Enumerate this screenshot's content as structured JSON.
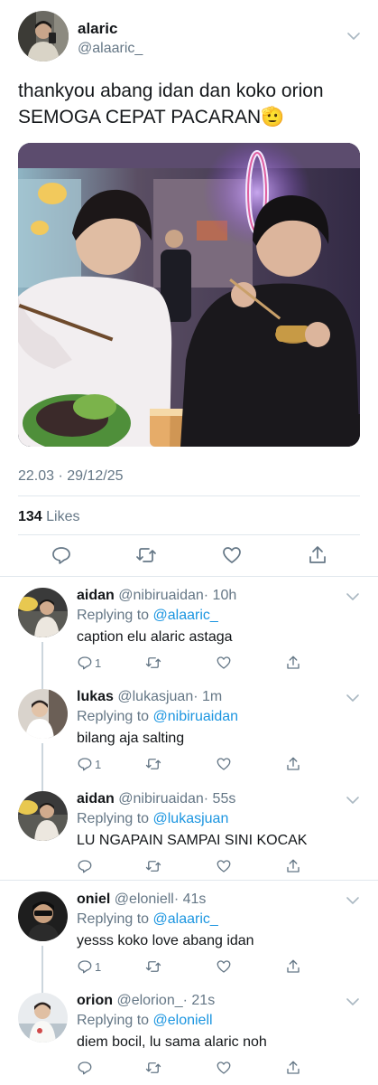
{
  "tweet": {
    "author_name": "alaric",
    "author_handle": "@alaaric_",
    "text_line1": "thankyou abang idan dan koko orion",
    "text_line2": "SEMOGA CEPAT PACARAN",
    "emoji": "🫡",
    "timestamp": "22.03 · 29/12/25",
    "likes_count": "134",
    "likes_label": "Likes",
    "actions": [
      "reply-icon",
      "retweet-icon",
      "like-icon",
      "share-icon"
    ]
  },
  "replies": [
    {
      "name": "aidan",
      "handle": "@nibiruaidan",
      "time": "· 10h",
      "replying_prefix": "Replying to",
      "replying_to": "@alaaric_",
      "text": "caption elu alaric astaga",
      "reply_count": "1"
    },
    {
      "name": "lukas",
      "handle": "@lukasjuan",
      "time": "· 1m",
      "replying_prefix": "Replying to",
      "replying_to": "@nibiruaidan",
      "text": "bilang aja salting",
      "reply_count": "1"
    },
    {
      "name": "aidan",
      "handle": "@nibiruaidan",
      "time": "· 55s",
      "replying_prefix": "Replying to",
      "replying_to": "@lukasjuan",
      "text": "LU NGAPAIN SAMPAI SINI KOCAK",
      "reply_count": ""
    },
    {
      "name": "oniel",
      "handle": "@eloniell",
      "time": "· 41s",
      "replying_prefix": "Replying to",
      "replying_to": "@alaaric_",
      "text": "yesss koko love abang idan",
      "reply_count": "1"
    },
    {
      "name": "orion",
      "handle": "@elorion_",
      "time": "· 21s",
      "replying_prefix": "Replying to",
      "replying_to": "@eloniell",
      "text": "diem bocil, lu sama alaric noh",
      "reply_count": ""
    }
  ],
  "colors": {
    "text": "#14171a",
    "secondary": "#657786",
    "link": "#1b95e0",
    "divider": "#e1e8ed"
  }
}
